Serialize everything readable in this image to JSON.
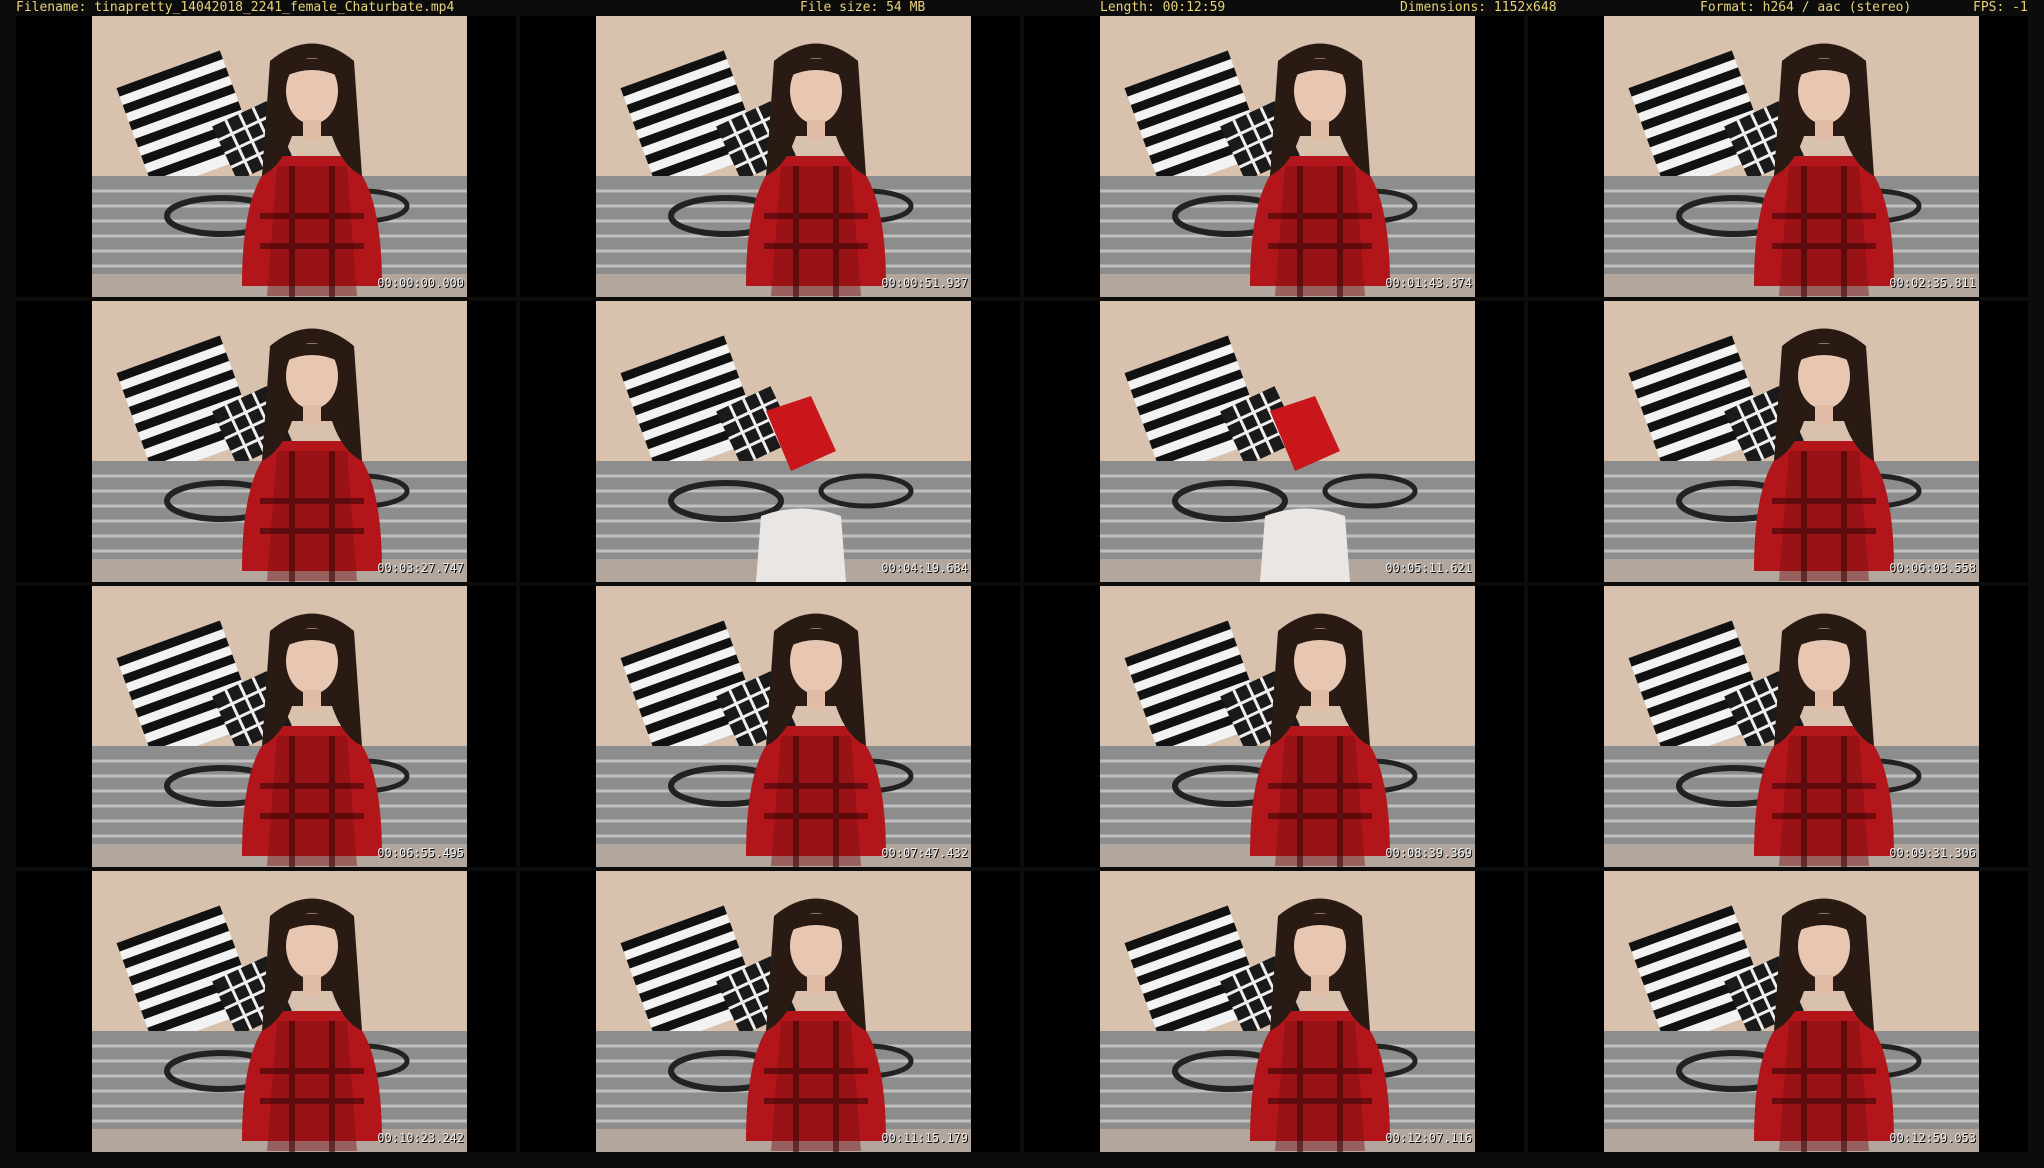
{
  "header": {
    "filename": "Filename: tinapretty_14042018_2241_female_Chaturbate.mp4",
    "filesize": "File size: 54 MB",
    "length": "Length: 00:12:59",
    "dimensions": "Dimensions: 1152x648",
    "format": "Format: h264 / aac (stereo)",
    "fps": "FPS: -1"
  },
  "thumbnails": [
    {
      "timestamp": "00:00:00.000",
      "person": true,
      "chair": false,
      "red_pillow": false
    },
    {
      "timestamp": "00:00:51.937",
      "person": true,
      "chair": false,
      "red_pillow": false
    },
    {
      "timestamp": "00:01:43.874",
      "person": true,
      "chair": false,
      "red_pillow": false
    },
    {
      "timestamp": "00:02:35.811",
      "person": true,
      "chair": false,
      "red_pillow": false
    },
    {
      "timestamp": "00:03:27.747",
      "person": true,
      "chair": false,
      "red_pillow": false
    },
    {
      "timestamp": "00:04:19.684",
      "person": false,
      "chair": true,
      "red_pillow": true
    },
    {
      "timestamp": "00:05:11.621",
      "person": false,
      "chair": true,
      "red_pillow": true
    },
    {
      "timestamp": "00:06:03.558",
      "person": true,
      "chair": false,
      "red_pillow": false
    },
    {
      "timestamp": "00:06:55.495",
      "person": true,
      "chair": false,
      "red_pillow": false
    },
    {
      "timestamp": "00:07:47.432",
      "person": true,
      "chair": false,
      "red_pillow": false
    },
    {
      "timestamp": "00:08:39.369",
      "person": true,
      "chair": false,
      "red_pillow": false
    },
    {
      "timestamp": "00:09:31.306",
      "person": true,
      "chair": false,
      "red_pillow": false
    },
    {
      "timestamp": "00:10:23.242",
      "person": true,
      "chair": false,
      "red_pillow": false
    },
    {
      "timestamp": "00:11:15.179",
      "person": true,
      "chair": false,
      "red_pillow": false
    },
    {
      "timestamp": "00:12:07.116",
      "person": true,
      "chair": false,
      "red_pillow": false
    },
    {
      "timestamp": "00:12:59.053",
      "person": true,
      "chair": false,
      "red_pillow": false
    }
  ],
  "colors": {
    "header_text": "#e8d27a",
    "timestamp_text": "#f0f0f0",
    "wall": "#d8c1ad",
    "shirt": "#b3161a",
    "hair": "#2a1a14"
  }
}
